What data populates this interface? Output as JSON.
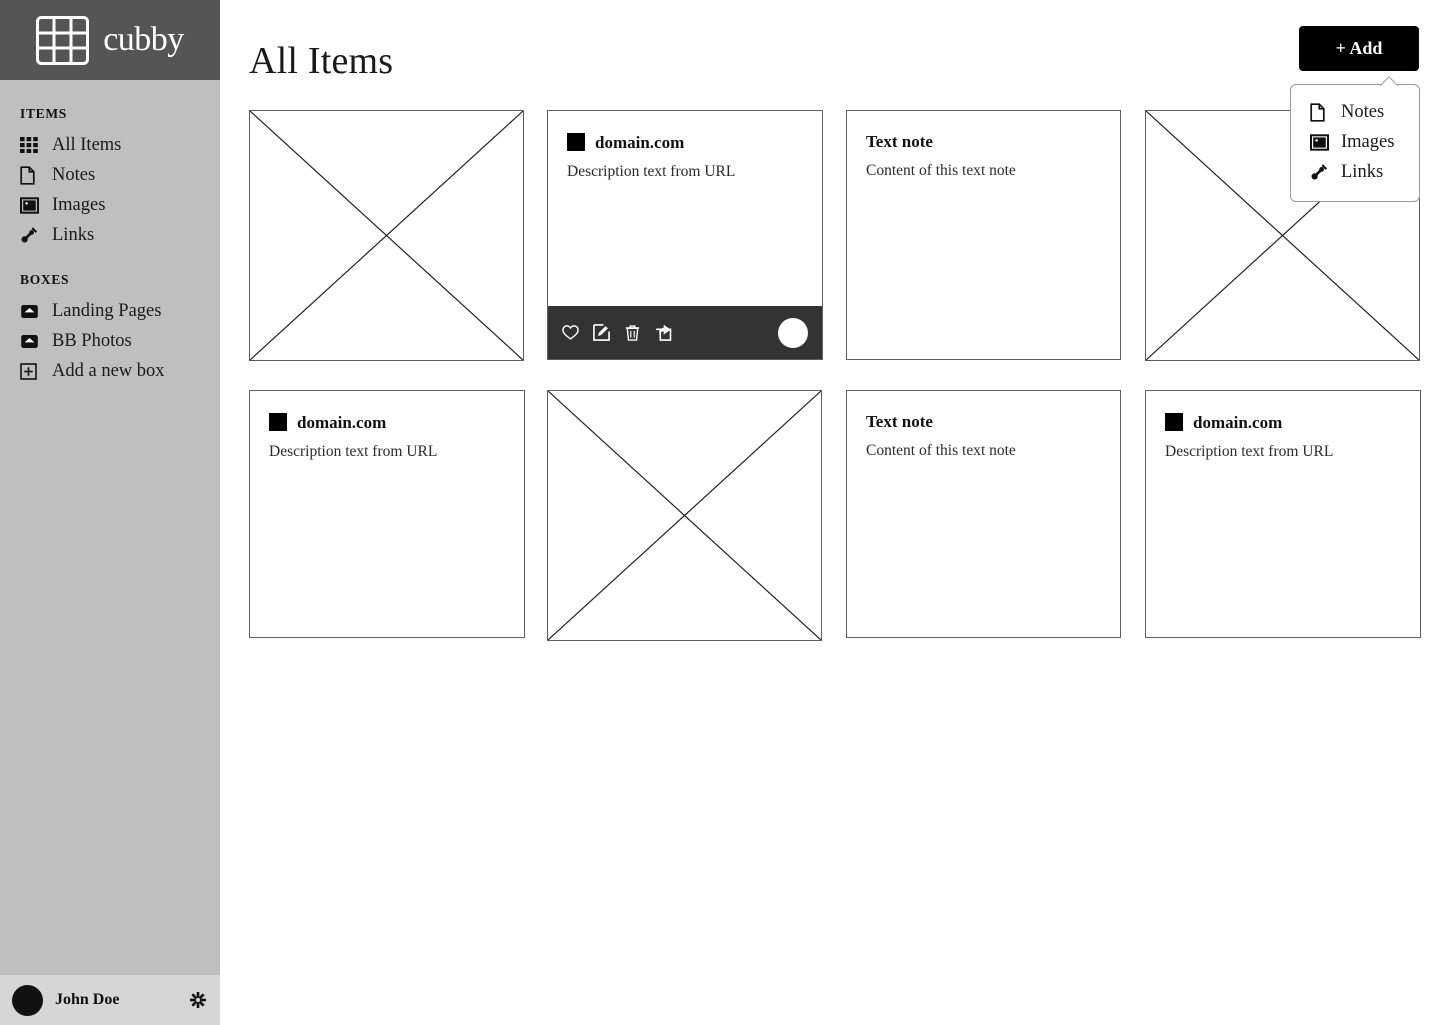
{
  "brand": {
    "name": "cubby",
    "logo_icon": "grid-logo-icon",
    "bar_color": "#555555"
  },
  "sidebar": {
    "background_color": "#bfbfbf",
    "sections": [
      {
        "title": "ITEMS",
        "items": [
          {
            "label": "All Items",
            "icon": "grid-icon"
          },
          {
            "label": "Notes",
            "icon": "file-icon"
          },
          {
            "label": "Images",
            "icon": "image-icon"
          },
          {
            "label": "Links",
            "icon": "link-icon"
          }
        ]
      },
      {
        "title": "BOXES",
        "items": [
          {
            "label": "Landing Pages",
            "icon": "inbox-icon"
          },
          {
            "label": "BB Photos",
            "icon": "inbox-icon"
          },
          {
            "label": "Add a new box",
            "icon": "plus-square-icon"
          }
        ]
      }
    ],
    "footer": {
      "user_name": "John Doe",
      "avatar_icon": "avatar",
      "settings_icon": "gear-icon",
      "background_color": "#d6d6d6"
    }
  },
  "main": {
    "page_title": "All Items",
    "add_button": {
      "label": "+ Add",
      "color": "#000000"
    },
    "add_menu": {
      "open": true,
      "items": [
        {
          "label": "Notes",
          "icon": "file-icon"
        },
        {
          "label": "Images",
          "icon": "image-icon"
        },
        {
          "label": "Links",
          "icon": "link-icon"
        }
      ]
    },
    "cards": [
      {
        "type": "image",
        "placeholder_icon": "image-placeholder-x"
      },
      {
        "type": "link",
        "title": "domain.com",
        "description": "Description text from URL",
        "favicon": "favicon-square",
        "hovered": true,
        "toolbar": {
          "actions": [
            {
              "name": "favorite",
              "icon": "heart-icon"
            },
            {
              "name": "edit",
              "icon": "edit-square-icon"
            },
            {
              "name": "delete",
              "icon": "trash-icon"
            },
            {
              "name": "share",
              "icon": "share-icon"
            }
          ],
          "avatar_icon": "circle-avatar"
        }
      },
      {
        "type": "note",
        "title": "Text note",
        "description": "Content of this text note"
      },
      {
        "type": "image",
        "placeholder_icon": "image-placeholder-x"
      },
      {
        "type": "link",
        "title": "domain.com",
        "description": "Description text from URL",
        "favicon": "favicon-square"
      },
      {
        "type": "image",
        "placeholder_icon": "image-placeholder-x"
      },
      {
        "type": "note",
        "title": "Text note",
        "description": "Content of this text note"
      },
      {
        "type": "link",
        "title": "domain.com",
        "description": "Description text from URL",
        "favicon": "favicon-square"
      }
    ]
  }
}
